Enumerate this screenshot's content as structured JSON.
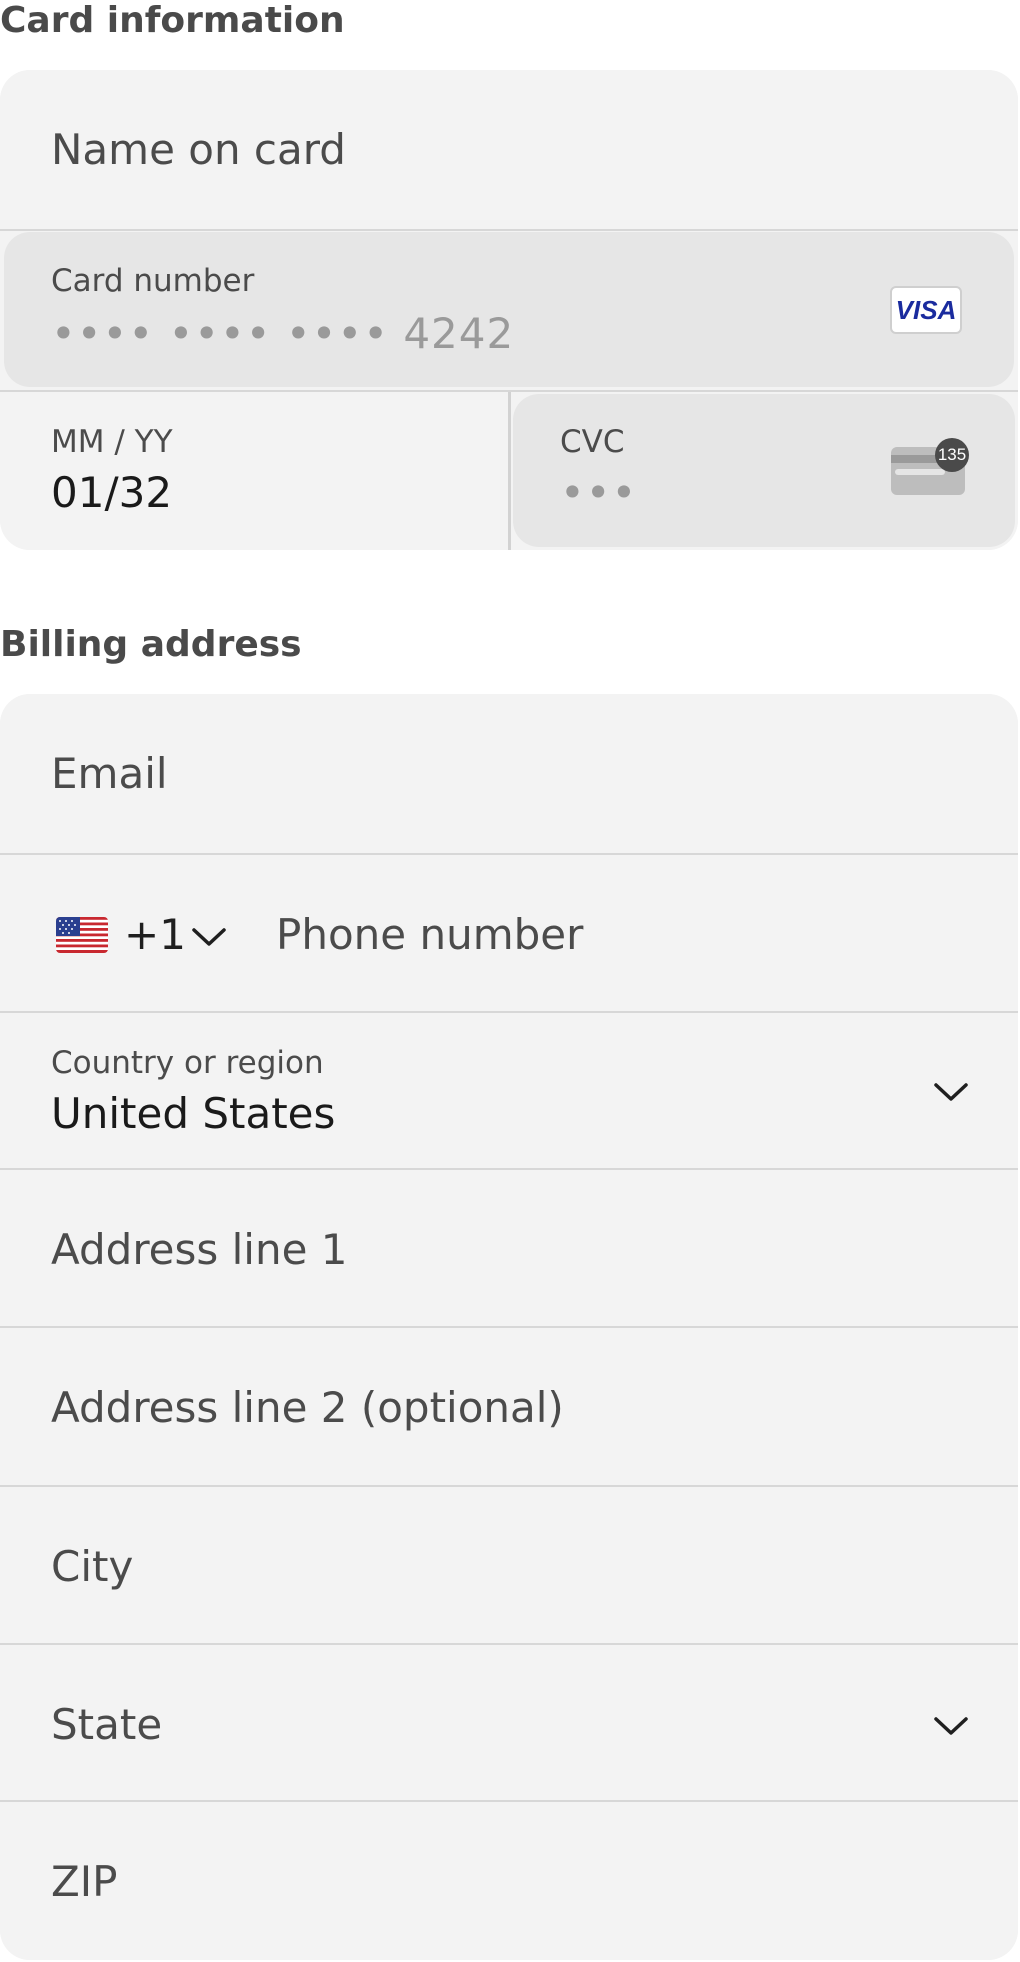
{
  "card_section": {
    "title": "Card information",
    "name_placeholder": "Name on card",
    "card_number": {
      "label": "Card number",
      "masked_value": "•••• •••• •••• 4242",
      "brand": "VISA"
    },
    "expiry": {
      "label": "MM / YY",
      "value": "01/32"
    },
    "cvc": {
      "label": "CVC",
      "masked_value": "•••",
      "icon_number": "135"
    }
  },
  "billing_section": {
    "title": "Billing address",
    "email_placeholder": "Email",
    "phone": {
      "country_code": "+1",
      "flag": "us-flag-icon",
      "placeholder": "Phone number"
    },
    "country": {
      "label": "Country or region",
      "value": "United States"
    },
    "address_line1_placeholder": "Address line 1",
    "address_line2_placeholder": "Address line 2 (optional)",
    "city_placeholder": "City",
    "state_placeholder": "State",
    "zip_placeholder": "ZIP"
  },
  "colors": {
    "field_background": "#f3f3f3",
    "focused_background": "#e6e6e6",
    "divider": "#d7d7d7",
    "visa_blue": "#1a2b9e"
  }
}
